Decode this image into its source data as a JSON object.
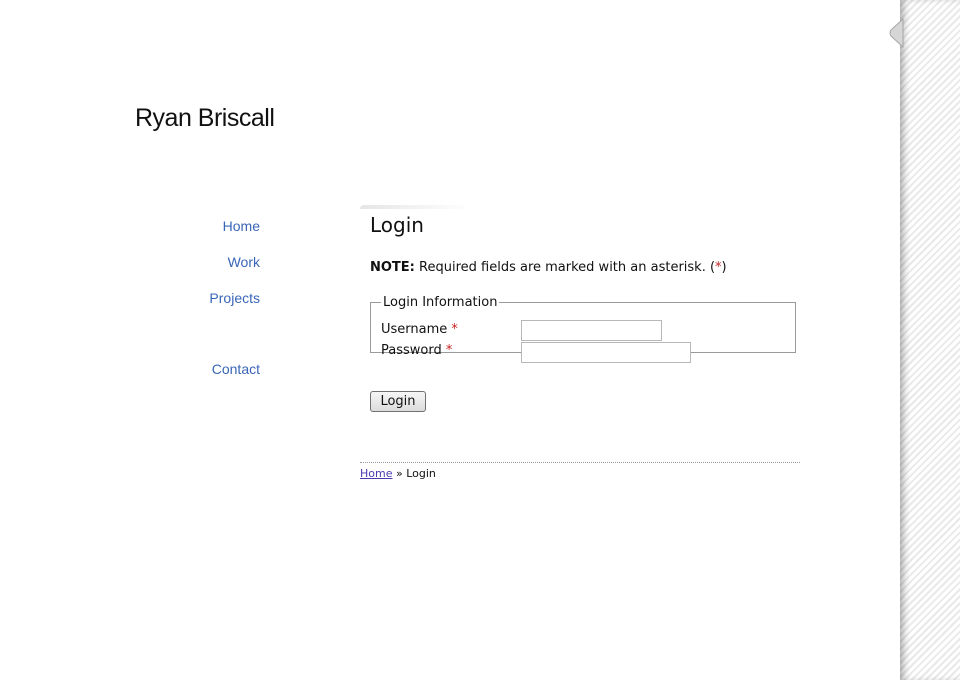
{
  "site": {
    "title": "Ryan Briscall"
  },
  "nav": {
    "items": [
      {
        "label": "Home"
      },
      {
        "label": "Work"
      },
      {
        "label": "Projects"
      },
      {
        "label": "Contact"
      }
    ]
  },
  "main": {
    "heading": "Login",
    "note": {
      "label": "NOTE:",
      "text": "Required fields are marked with an asterisk. (",
      "asterisk": "*",
      "close": ")"
    },
    "form": {
      "legend": "Login Information",
      "username": {
        "label": "Username",
        "required_mark": "*",
        "value": "",
        "placeholder": ""
      },
      "password": {
        "label": "Password",
        "required_mark": "*",
        "value": "",
        "placeholder": ""
      },
      "submit_label": "Login"
    }
  },
  "breadcrumb": {
    "home": "Home",
    "separator": "»",
    "current": "Login"
  },
  "colors": {
    "nav_link": "#3a66b7",
    "required": "#c82020",
    "breadcrumb_link": "#4a3bb0"
  }
}
